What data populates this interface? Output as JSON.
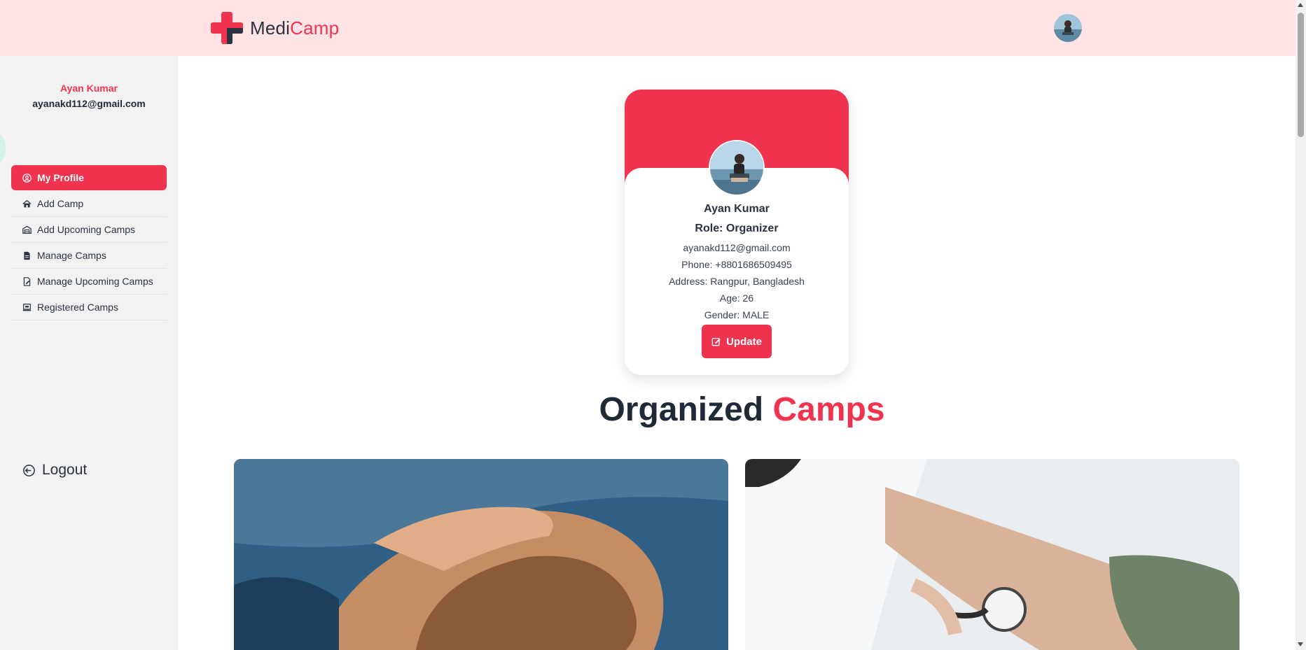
{
  "header": {
    "logo_prefix": "Medi",
    "logo_accent": "Camp",
    "logo_icon": "medical-cross-icon",
    "avatar_icon": "user-avatar"
  },
  "sidebar": {
    "user_name": "Ayan Kumar",
    "user_email": "ayanakd112@gmail.com",
    "items": [
      {
        "label": "My Profile",
        "icon": "user-circle-icon",
        "active": true
      },
      {
        "label": "Add Camp",
        "icon": "home-icon",
        "active": false
      },
      {
        "label": "Add Upcoming Camps",
        "icon": "warehouse-icon",
        "active": false
      },
      {
        "label": "Manage Camps",
        "icon": "document-icon",
        "active": false
      },
      {
        "label": "Manage Upcoming Camps",
        "icon": "edit-document-icon",
        "active": false
      },
      {
        "label": "Registered Camps",
        "icon": "laptop-icon",
        "active": false
      }
    ],
    "logout_label": "Logout"
  },
  "profile": {
    "name": "Ayan Kumar",
    "role": "Role: Organizer",
    "email": "ayanakd112@gmail.com",
    "phone": "Phone: +8801686509495",
    "address": "Address: Rangpur, Bangladesh",
    "age": "Age: 26",
    "gender": "Gender: MALE",
    "update_label": "Update"
  },
  "section": {
    "title_prefix": "Organized",
    "title_accent": "Camps"
  },
  "colors": {
    "accent": "#f0334f",
    "header_bg": "#ffe3e5",
    "sidebar_bg": "#f2f2f2",
    "text_dark": "#1f2937"
  }
}
